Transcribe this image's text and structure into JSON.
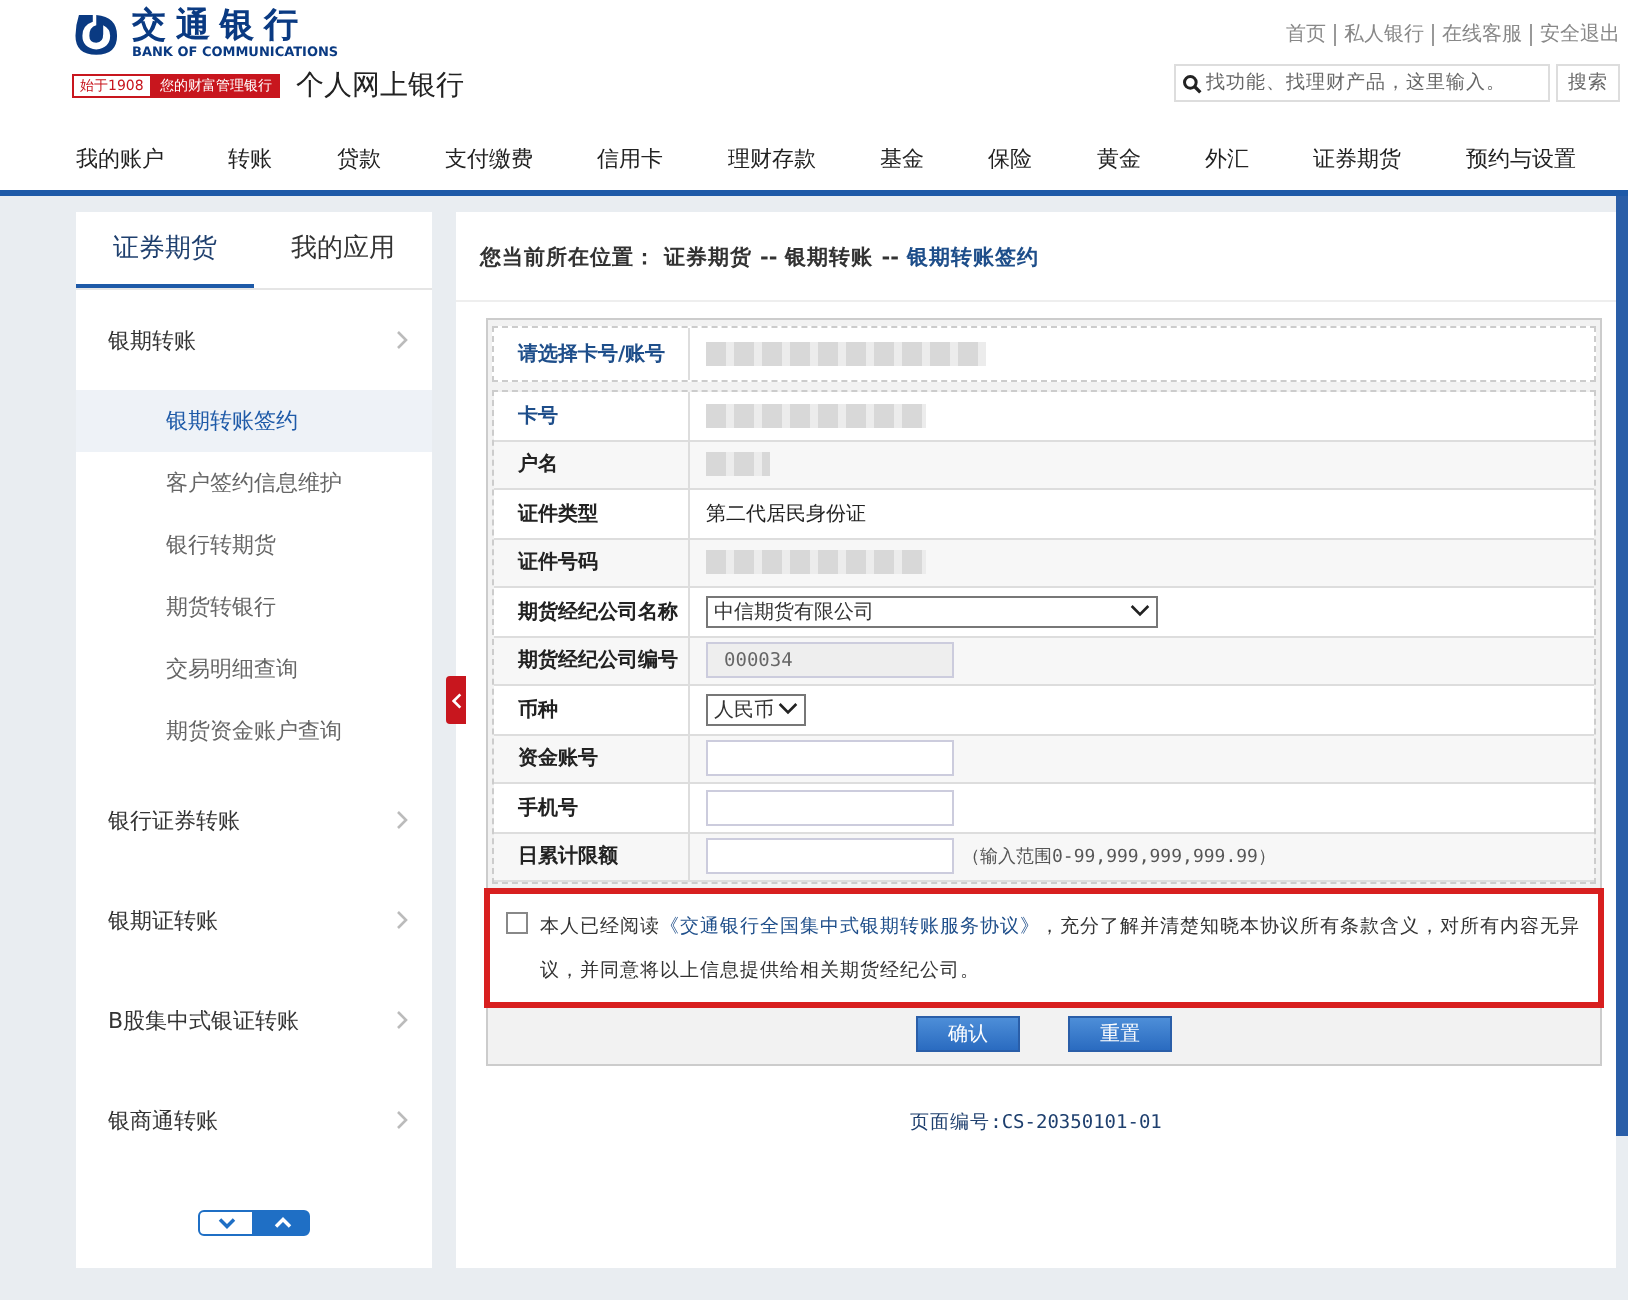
{
  "header": {
    "logo_cn": "交通银行",
    "logo_en": "BANK OF COMMUNICATIONS",
    "slogan_year": "始于1908",
    "slogan": "您的财富管理银行",
    "site_name": "个人网上银行",
    "top_links": [
      "首页",
      "私人银行",
      "在线客服",
      "安全退出"
    ],
    "search": {
      "placeholder": "找功能、找理财产品，这里输入。",
      "button": "搜索"
    }
  },
  "nav": [
    "我的账户",
    "转账",
    "贷款",
    "支付缴费",
    "信用卡",
    "理财存款",
    "基金",
    "保险",
    "黄金",
    "外汇",
    "证券期货",
    "预约与设置"
  ],
  "sidebar": {
    "tabs": [
      {
        "label": "证券期货",
        "selected": true
      },
      {
        "label": "我的应用",
        "selected": false
      }
    ],
    "menu": [
      {
        "label": "银期转账",
        "children": [
          {
            "label": "银期转账签约",
            "selected": true
          },
          {
            "label": "客户签约信息维护",
            "selected": false
          },
          {
            "label": "银行转期货",
            "selected": false
          },
          {
            "label": "期货转银行",
            "selected": false
          },
          {
            "label": "交易明细查询",
            "selected": false
          },
          {
            "label": "期货资金账户查询",
            "selected": false
          }
        ]
      },
      {
        "label": "银行证券转账"
      },
      {
        "label": "银期证转账"
      },
      {
        "label": "B股集中式银证转账"
      },
      {
        "label": "银商通转账"
      }
    ]
  },
  "breadcrumb": {
    "prefix": "您当前所在位置：",
    "items": [
      {
        "label": "证券期货",
        "current": false
      },
      {
        "label": "银期转账",
        "current": false
      },
      {
        "label": "银期转账签约",
        "current": true
      }
    ],
    "separators": [
      "--",
      "--"
    ]
  },
  "card_row": {
    "label": "请选择卡号/账号",
    "kind": "redacted"
  },
  "rows": [
    {
      "label": "卡号",
      "kind": "redacted"
    },
    {
      "label": "户名",
      "kind": "redacted"
    },
    {
      "label": "证件类型",
      "kind": "text",
      "value": "第二代居民身份证"
    },
    {
      "label": "证件号码",
      "kind": "redacted"
    },
    {
      "label": "期货经纪公司名称",
      "kind": "select",
      "value": "中信期货有限公司"
    },
    {
      "label": "期货经纪公司编号",
      "kind": "readonly",
      "value": "000034"
    },
    {
      "label": "币种",
      "kind": "smallselect",
      "value": "人民币"
    },
    {
      "label": "资金账号",
      "kind": "input"
    },
    {
      "label": "手机号",
      "kind": "input"
    },
    {
      "label": "日累计限额",
      "kind": "input",
      "hint": "（输入范围0-99,999,999,999.99）"
    }
  ],
  "agreement": {
    "checked": false,
    "before": "本人已经阅读",
    "link": "《交通银行全国集中式银期转账服务协议》",
    "after": "，充分了解并清楚知晓本协议所有条款含义，对所有内容无异议，并同意将以上信息提供给相关期货经纪公司。"
  },
  "buttons": [
    "确认",
    "重置"
  ],
  "page_code": "页面编号:CS-20350101-01"
}
